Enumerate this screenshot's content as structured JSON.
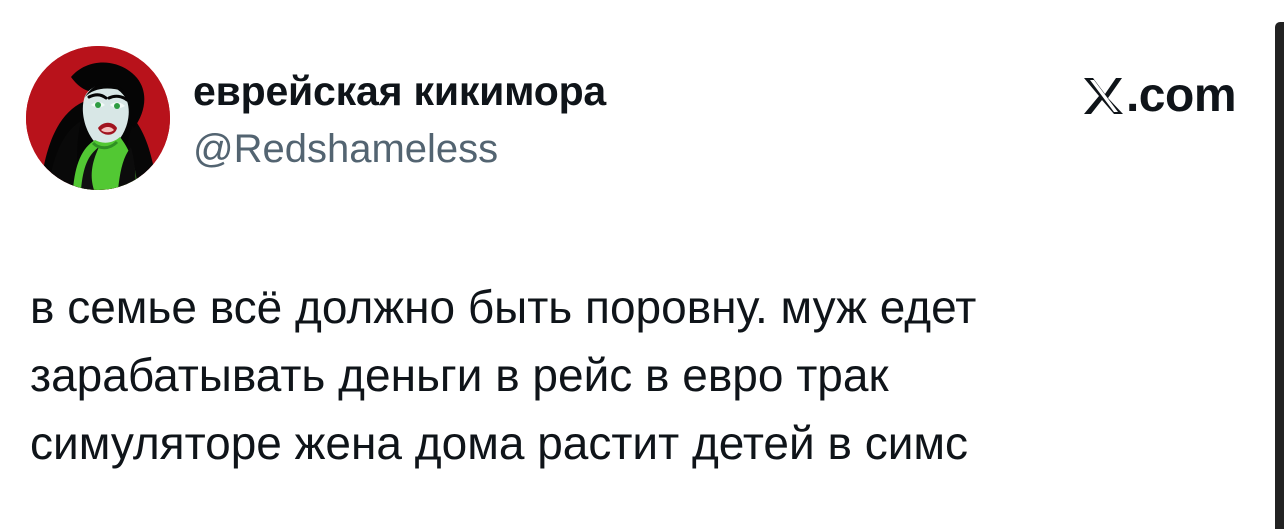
{
  "tweet": {
    "author": {
      "display_name": "еврейская кикимора",
      "handle": "@Redshameless",
      "avatar_icon": "cartoon-character-avatar-icon"
    },
    "brand": {
      "text": ".com",
      "icon": "x-logo-icon"
    },
    "text_lines": [
      "в семье всё должно быть поровну. муж едет",
      "зарабатывать деньги в рейс в евро трак",
      "симуляторе жена дома растит детей в симс"
    ]
  },
  "colors": {
    "text_primary": "#0f1419",
    "text_secondary": "#536471",
    "background": "#ffffff",
    "avatar_red": "#b8121b",
    "avatar_green": "#52c833",
    "scrollbar": "#222222"
  }
}
